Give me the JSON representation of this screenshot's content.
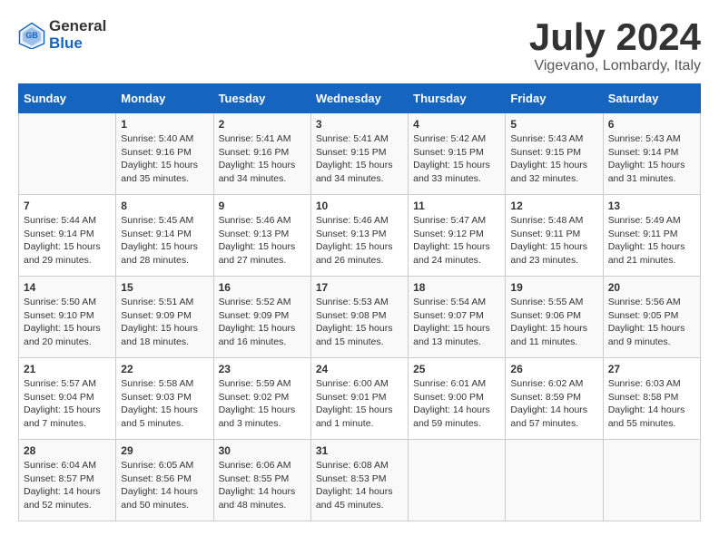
{
  "header": {
    "logo_line1": "General",
    "logo_line2": "Blue",
    "month_year": "July 2024",
    "location": "Vigevano, Lombardy, Italy"
  },
  "weekdays": [
    "Sunday",
    "Monday",
    "Tuesday",
    "Wednesday",
    "Thursday",
    "Friday",
    "Saturday"
  ],
  "weeks": [
    [
      {
        "day": "",
        "content": ""
      },
      {
        "day": "1",
        "content": "Sunrise: 5:40 AM\nSunset: 9:16 PM\nDaylight: 15 hours\nand 35 minutes."
      },
      {
        "day": "2",
        "content": "Sunrise: 5:41 AM\nSunset: 9:16 PM\nDaylight: 15 hours\nand 34 minutes."
      },
      {
        "day": "3",
        "content": "Sunrise: 5:41 AM\nSunset: 9:15 PM\nDaylight: 15 hours\nand 34 minutes."
      },
      {
        "day": "4",
        "content": "Sunrise: 5:42 AM\nSunset: 9:15 PM\nDaylight: 15 hours\nand 33 minutes."
      },
      {
        "day": "5",
        "content": "Sunrise: 5:43 AM\nSunset: 9:15 PM\nDaylight: 15 hours\nand 32 minutes."
      },
      {
        "day": "6",
        "content": "Sunrise: 5:43 AM\nSunset: 9:14 PM\nDaylight: 15 hours\nand 31 minutes."
      }
    ],
    [
      {
        "day": "7",
        "content": "Sunrise: 5:44 AM\nSunset: 9:14 PM\nDaylight: 15 hours\nand 29 minutes."
      },
      {
        "day": "8",
        "content": "Sunrise: 5:45 AM\nSunset: 9:14 PM\nDaylight: 15 hours\nand 28 minutes."
      },
      {
        "day": "9",
        "content": "Sunrise: 5:46 AM\nSunset: 9:13 PM\nDaylight: 15 hours\nand 27 minutes."
      },
      {
        "day": "10",
        "content": "Sunrise: 5:46 AM\nSunset: 9:13 PM\nDaylight: 15 hours\nand 26 minutes."
      },
      {
        "day": "11",
        "content": "Sunrise: 5:47 AM\nSunset: 9:12 PM\nDaylight: 15 hours\nand 24 minutes."
      },
      {
        "day": "12",
        "content": "Sunrise: 5:48 AM\nSunset: 9:11 PM\nDaylight: 15 hours\nand 23 minutes."
      },
      {
        "day": "13",
        "content": "Sunrise: 5:49 AM\nSunset: 9:11 PM\nDaylight: 15 hours\nand 21 minutes."
      }
    ],
    [
      {
        "day": "14",
        "content": "Sunrise: 5:50 AM\nSunset: 9:10 PM\nDaylight: 15 hours\nand 20 minutes."
      },
      {
        "day": "15",
        "content": "Sunrise: 5:51 AM\nSunset: 9:09 PM\nDaylight: 15 hours\nand 18 minutes."
      },
      {
        "day": "16",
        "content": "Sunrise: 5:52 AM\nSunset: 9:09 PM\nDaylight: 15 hours\nand 16 minutes."
      },
      {
        "day": "17",
        "content": "Sunrise: 5:53 AM\nSunset: 9:08 PM\nDaylight: 15 hours\nand 15 minutes."
      },
      {
        "day": "18",
        "content": "Sunrise: 5:54 AM\nSunset: 9:07 PM\nDaylight: 15 hours\nand 13 minutes."
      },
      {
        "day": "19",
        "content": "Sunrise: 5:55 AM\nSunset: 9:06 PM\nDaylight: 15 hours\nand 11 minutes."
      },
      {
        "day": "20",
        "content": "Sunrise: 5:56 AM\nSunset: 9:05 PM\nDaylight: 15 hours\nand 9 minutes."
      }
    ],
    [
      {
        "day": "21",
        "content": "Sunrise: 5:57 AM\nSunset: 9:04 PM\nDaylight: 15 hours\nand 7 minutes."
      },
      {
        "day": "22",
        "content": "Sunrise: 5:58 AM\nSunset: 9:03 PM\nDaylight: 15 hours\nand 5 minutes."
      },
      {
        "day": "23",
        "content": "Sunrise: 5:59 AM\nSunset: 9:02 PM\nDaylight: 15 hours\nand 3 minutes."
      },
      {
        "day": "24",
        "content": "Sunrise: 6:00 AM\nSunset: 9:01 PM\nDaylight: 15 hours\nand 1 minute."
      },
      {
        "day": "25",
        "content": "Sunrise: 6:01 AM\nSunset: 9:00 PM\nDaylight: 14 hours\nand 59 minutes."
      },
      {
        "day": "26",
        "content": "Sunrise: 6:02 AM\nSunset: 8:59 PM\nDaylight: 14 hours\nand 57 minutes."
      },
      {
        "day": "27",
        "content": "Sunrise: 6:03 AM\nSunset: 8:58 PM\nDaylight: 14 hours\nand 55 minutes."
      }
    ],
    [
      {
        "day": "28",
        "content": "Sunrise: 6:04 AM\nSunset: 8:57 PM\nDaylight: 14 hours\nand 52 minutes."
      },
      {
        "day": "29",
        "content": "Sunrise: 6:05 AM\nSunset: 8:56 PM\nDaylight: 14 hours\nand 50 minutes."
      },
      {
        "day": "30",
        "content": "Sunrise: 6:06 AM\nSunset: 8:55 PM\nDaylight: 14 hours\nand 48 minutes."
      },
      {
        "day": "31",
        "content": "Sunrise: 6:08 AM\nSunset: 8:53 PM\nDaylight: 14 hours\nand 45 minutes."
      },
      {
        "day": "",
        "content": ""
      },
      {
        "day": "",
        "content": ""
      },
      {
        "day": "",
        "content": ""
      }
    ]
  ]
}
